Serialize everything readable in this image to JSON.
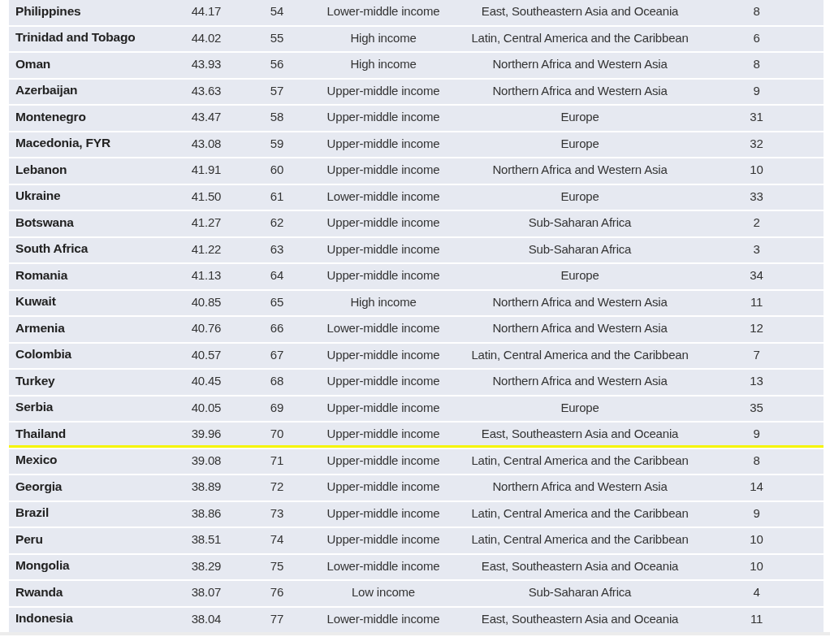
{
  "rows": [
    {
      "country": "Philippines",
      "score": "44.17",
      "rank": "54",
      "income": "Lower-middle income",
      "region": "East, Southeastern Asia and Oceania",
      "region_rank": "8",
      "marked": false
    },
    {
      "country": "Trinidad and Tobago",
      "score": "44.02",
      "rank": "55",
      "income": "High income",
      "region": "Latin, Central America and the Caribbean",
      "region_rank": "6",
      "marked": false
    },
    {
      "country": "Oman",
      "score": "43.93",
      "rank": "56",
      "income": "High income",
      "region": "Northern Africa and Western Asia",
      "region_rank": "8",
      "marked": false
    },
    {
      "country": "Azerbaijan",
      "score": "43.63",
      "rank": "57",
      "income": "Upper-middle income",
      "region": "Northern Africa and Western Asia",
      "region_rank": "9",
      "marked": false
    },
    {
      "country": "Montenegro",
      "score": "43.47",
      "rank": "58",
      "income": "Upper-middle income",
      "region": "Europe",
      "region_rank": "31",
      "marked": false
    },
    {
      "country": "Macedonia, FYR",
      "score": "43.08",
      "rank": "59",
      "income": "Upper-middle income",
      "region": "Europe",
      "region_rank": "32",
      "marked": false
    },
    {
      "country": "Lebanon",
      "score": "41.91",
      "rank": "60",
      "income": "Upper-middle income",
      "region": "Northern Africa and Western Asia",
      "region_rank": "10",
      "marked": false
    },
    {
      "country": "Ukraine",
      "score": "41.50",
      "rank": "61",
      "income": "Lower-middle income",
      "region": "Europe",
      "region_rank": "33",
      "marked": false
    },
    {
      "country": "Botswana",
      "score": "41.27",
      "rank": "62",
      "income": "Upper-middle income",
      "region": "Sub-Saharan Africa",
      "region_rank": "2",
      "marked": false
    },
    {
      "country": "South Africa",
      "score": "41.22",
      "rank": "63",
      "income": "Upper-middle income",
      "region": "Sub-Saharan Africa",
      "region_rank": "3",
      "marked": false
    },
    {
      "country": "Romania",
      "score": "41.13",
      "rank": "64",
      "income": "Upper-middle income",
      "region": "Europe",
      "region_rank": "34",
      "marked": false
    },
    {
      "country": "Kuwait",
      "score": "40.85",
      "rank": "65",
      "income": "High income",
      "region": "Northern Africa and Western Asia",
      "region_rank": "11",
      "marked": false
    },
    {
      "country": "Armenia",
      "score": "40.76",
      "rank": "66",
      "income": "Lower-middle income",
      "region": "Northern Africa and Western Asia",
      "region_rank": "12",
      "marked": false
    },
    {
      "country": "Colombia",
      "score": "40.57",
      "rank": "67",
      "income": "Upper-middle income",
      "region": "Latin, Central America and the Caribbean",
      "region_rank": "7",
      "marked": false
    },
    {
      "country": "Turkey",
      "score": "40.45",
      "rank": "68",
      "income": "Upper-middle income",
      "region": "Northern Africa and Western Asia",
      "region_rank": "13",
      "marked": false
    },
    {
      "country": "Serbia",
      "score": "40.05",
      "rank": "69",
      "income": "Upper-middle income",
      "region": "Europe",
      "region_rank": "35",
      "marked": false
    },
    {
      "country": "Thailand",
      "score": "39.96",
      "rank": "70",
      "income": "Upper-middle income",
      "region": "East, Southeastern Asia and Oceania",
      "region_rank": "9",
      "marked": true
    },
    {
      "country": "Mexico",
      "score": "39.08",
      "rank": "71",
      "income": "Upper-middle income",
      "region": "Latin, Central America and the Caribbean",
      "region_rank": "8",
      "marked": false
    },
    {
      "country": "Georgia",
      "score": "38.89",
      "rank": "72",
      "income": "Upper-middle income",
      "region": "Northern Africa and Western Asia",
      "region_rank": "14",
      "marked": false
    },
    {
      "country": "Brazil",
      "score": "38.86",
      "rank": "73",
      "income": "Upper-middle income",
      "region": "Latin, Central America and the Caribbean",
      "region_rank": "9",
      "marked": false
    },
    {
      "country": "Peru",
      "score": "38.51",
      "rank": "74",
      "income": "Upper-middle income",
      "region": "Latin, Central America and the Caribbean",
      "region_rank": "10",
      "marked": false
    },
    {
      "country": "Mongolia",
      "score": "38.29",
      "rank": "75",
      "income": "Lower-middle income",
      "region": "East, Southeastern Asia and Oceania",
      "region_rank": "10",
      "marked": false
    },
    {
      "country": "Rwanda",
      "score": "38.07",
      "rank": "76",
      "income": "Low income",
      "region": "Sub-Saharan Africa",
      "region_rank": "4",
      "marked": false
    },
    {
      "country": "Indonesia",
      "score": "38.04",
      "rank": "77",
      "income": "Lower-middle income",
      "region": "East, Southeastern Asia and Oceania",
      "region_rank": "11",
      "marked": false
    }
  ]
}
